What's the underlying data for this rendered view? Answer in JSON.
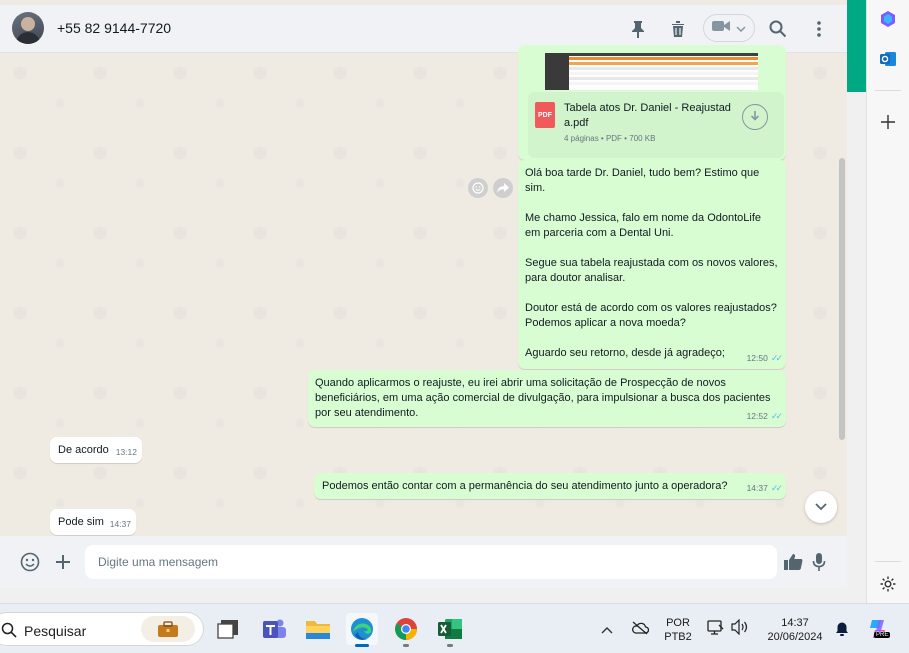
{
  "header": {
    "contact_name": "+55 82 9144-7720",
    "icons": [
      "pin-icon",
      "trash-icon",
      "video-call-icon",
      "search-icon",
      "menu-icon"
    ]
  },
  "document": {
    "title": "Tabela atos Dr. Daniel - Reajustad a.pdf",
    "meta": "4 páginas • PDF • 700 KB",
    "badge": "PDF"
  },
  "messages": {
    "m1": {
      "p1": "Olá boa tarde Dr. Daniel, tudo bem? Estimo que sim.",
      "p2": "Me chamo Jessica, falo em nome da OdontoLife em parceria com a Dental Uni.",
      "p3": "Segue sua tabela reajustada com os novos valores, para doutor analisar.",
      "p4": "Doutor está de acordo com os valores reajustados? Podemos aplicar a nova moeda?",
      "p5": "Aguardo seu retorno, desde já agradeço;",
      "time": "12:50"
    },
    "m2": {
      "text": "Quando aplicarmos o reajuste, eu irei abrir uma solicitação de Prospecção de novos beneficiários, em uma ação comercial de divulgação, para impulsionar a busca dos pacientes por seu atendimento.",
      "time": "12:52"
    },
    "m3": {
      "text": "De acordo",
      "time": "13:12"
    },
    "m4": {
      "text": "Podemos então contar com a permanência do seu atendimento junto a operadora?",
      "time": "14:37"
    },
    "m5": {
      "text": "Pode sim",
      "time": "14:37"
    }
  },
  "composer": {
    "placeholder": "Digite uma mensagem"
  },
  "taskbar": {
    "search_label": "Pesquisar",
    "lang_top": "POR",
    "lang_bottom": "PTB2",
    "clock_time": "14:37",
    "clock_date": "20/06/2024",
    "copilot_badge": "PRE"
  },
  "colors": {
    "accent": "#00a884",
    "outgoing_bubble": "#d9fdd3",
    "incoming_bubble": "#ffffff",
    "chat_bg": "#efeae2",
    "read_ticks": "#53bdeb"
  }
}
